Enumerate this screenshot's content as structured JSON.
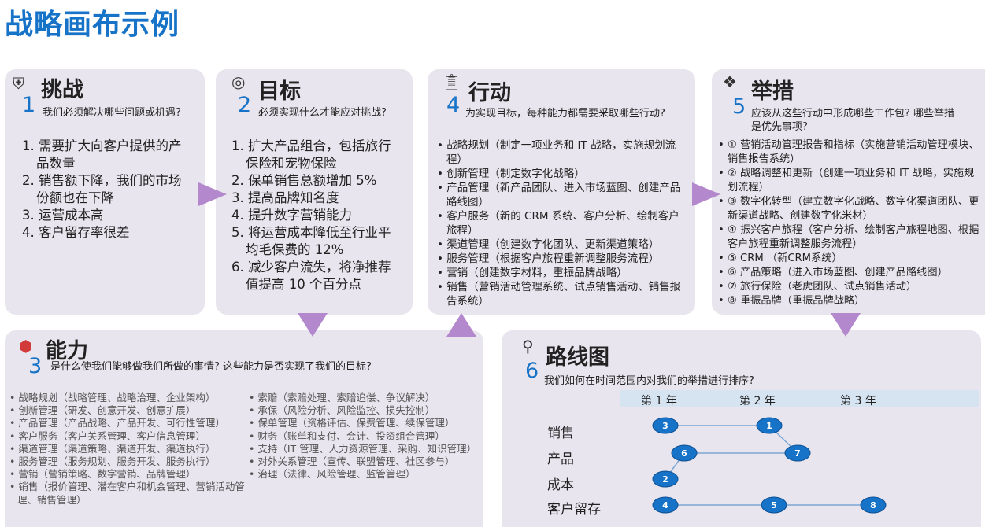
{
  "title": "战略画布示例",
  "challenges": {
    "heading": "挑战",
    "number": "1",
    "question": "我们必须解决哪些问题或机遇?",
    "items": [
      "1. 需要扩大向客户提供的产品数量",
      "2. 销售额下降，我们的市场份额也在下降",
      "3. 运营成本高",
      "4. 客户留存率很差"
    ]
  },
  "goals": {
    "heading": "目标",
    "number": "2",
    "question": "必须实现什么才能应对挑战?",
    "items": [
      "1. 扩大产品组合，包括旅行保险和宠物保险",
      "2. 保单销售总额增加 5%",
      "3. 提高品牌知名度",
      "4. 提升数字营销能力",
      "5. 将运营成本降低至行业平均毛保费的 12%",
      "6. 减少客户流失，将净推荐值提高 10 个百分点"
    ]
  },
  "actions": {
    "heading": "行动",
    "number": "4",
    "question": "为实现目标，每种能力都需要采取哪些行动?",
    "items": [
      "战略规划（制定一项业务和 IT 战略，实施规划流程）",
      "创新管理（制定数字化战略）",
      "产品管理（新产品团队、进入市场蓝图、创建产品路线图）",
      "客户服务（新的 CRM 系统、客户分析、绘制客户旅程）",
      "渠道管理（创建数字化团队、更新渠道策略）",
      "服务管理（根据客户旅程重新调整服务流程）",
      "营销（创建数字材料，重振品牌战略）",
      "销售（营销活动管理系统、试点销售活动、销售报告系统）"
    ]
  },
  "initiatives": {
    "heading": "举措",
    "number": "5",
    "question": "应该从这些行动中形成哪些工作包? 哪些举措是优先事项?",
    "items": [
      "① 营销活动管理报告和指标（实施营销活动管理模块、销售报告系统）",
      "② 战略调整和更新（创建一项业务和 IT 战略，实施规划流程）",
      "③ 数字化转型（建立数字化战略、数字化渠道团队、更新渠道战略、创建数字化米材）",
      "④ 振兴客户旅程（客户分析、绘制客户旅程地图、根据客户旅程重新调整服务流程）",
      "⑤ CRM （新CRM系统）",
      "⑥ 产品策略（进入市场蓝图、创建产品路线图）",
      "⑦ 旅行保险（老虎团队、试点销售活动）",
      "⑧ 重振品牌（重振品牌战略）"
    ]
  },
  "capabilities": {
    "heading": "能力",
    "number": "3",
    "question": "是什么使我们能够做我们所做的事情? 这些能力是否实现了我们的目标?",
    "col1": [
      "战略规划（战略管理、战略治理、企业架构）",
      "创新管理（研发、创意开发、创意扩展）",
      "产品管理（产品战略、产品开发、可行性管理）",
      "客户服务（客户关系管理、客户信息管理）",
      "渠道管理（渠道策略、渠道开发、渠道执行）",
      "服务管理（服务规划、服务开发、服务执行）",
      "营销（营销策略、数字营销、品牌管理）",
      "销售（报价管理、潜在客户和机会管理、营销活动管理、销售管理）"
    ],
    "col2": [
      "索赔（索赔处理、索赔追偿、争议解决）",
      "承保（风险分析、风险监控、损失控制）",
      "保单管理（资格评估、保费管理、续保管理）",
      "财务（账单和支付、会计、投资组合管理）",
      "支持（IT 管理、人力资源管理、采购、知识管理）",
      "对外关系管理（宣传、联盟管理、社区参与）",
      "治理（法律、风险管理、监管管理）"
    ]
  },
  "roadmap": {
    "heading": "路线图",
    "number": "6",
    "question": "我们如何在时间范围内对我们的举措进行排序?",
    "years": [
      "第 1 年",
      "第 2 年",
      "第 3 年"
    ],
    "rows": [
      "销售",
      "产品",
      "成本",
      "客户留存"
    ],
    "nodes": [
      {
        "label": "3",
        "row": 0,
        "year": 0.15
      },
      {
        "label": "1",
        "row": 0,
        "year": 1.25
      },
      {
        "label": "6",
        "row": 1,
        "year": 0.35
      },
      {
        "label": "7",
        "row": 1,
        "year": 1.55
      },
      {
        "label": "2",
        "row": 2,
        "year": 0.15
      },
      {
        "label": "4",
        "row": 3,
        "year": 0.15
      },
      {
        "label": "5",
        "row": 3,
        "year": 1.3
      },
      {
        "label": "8",
        "row": 3,
        "year": 2.35
      }
    ],
    "links": [
      [
        0,
        1
      ],
      [
        1,
        3
      ],
      [
        2,
        3
      ],
      [
        2,
        4
      ],
      [
        5,
        6
      ],
      [
        6,
        7
      ]
    ],
    "colors": {
      "node": "#1673c7",
      "line": "#7aa7d6",
      "year_band": "#d6e4f2"
    }
  },
  "colors": {
    "accent": "#1673c7",
    "card": "#e9e5ee",
    "arrow": "#b388cc"
  }
}
